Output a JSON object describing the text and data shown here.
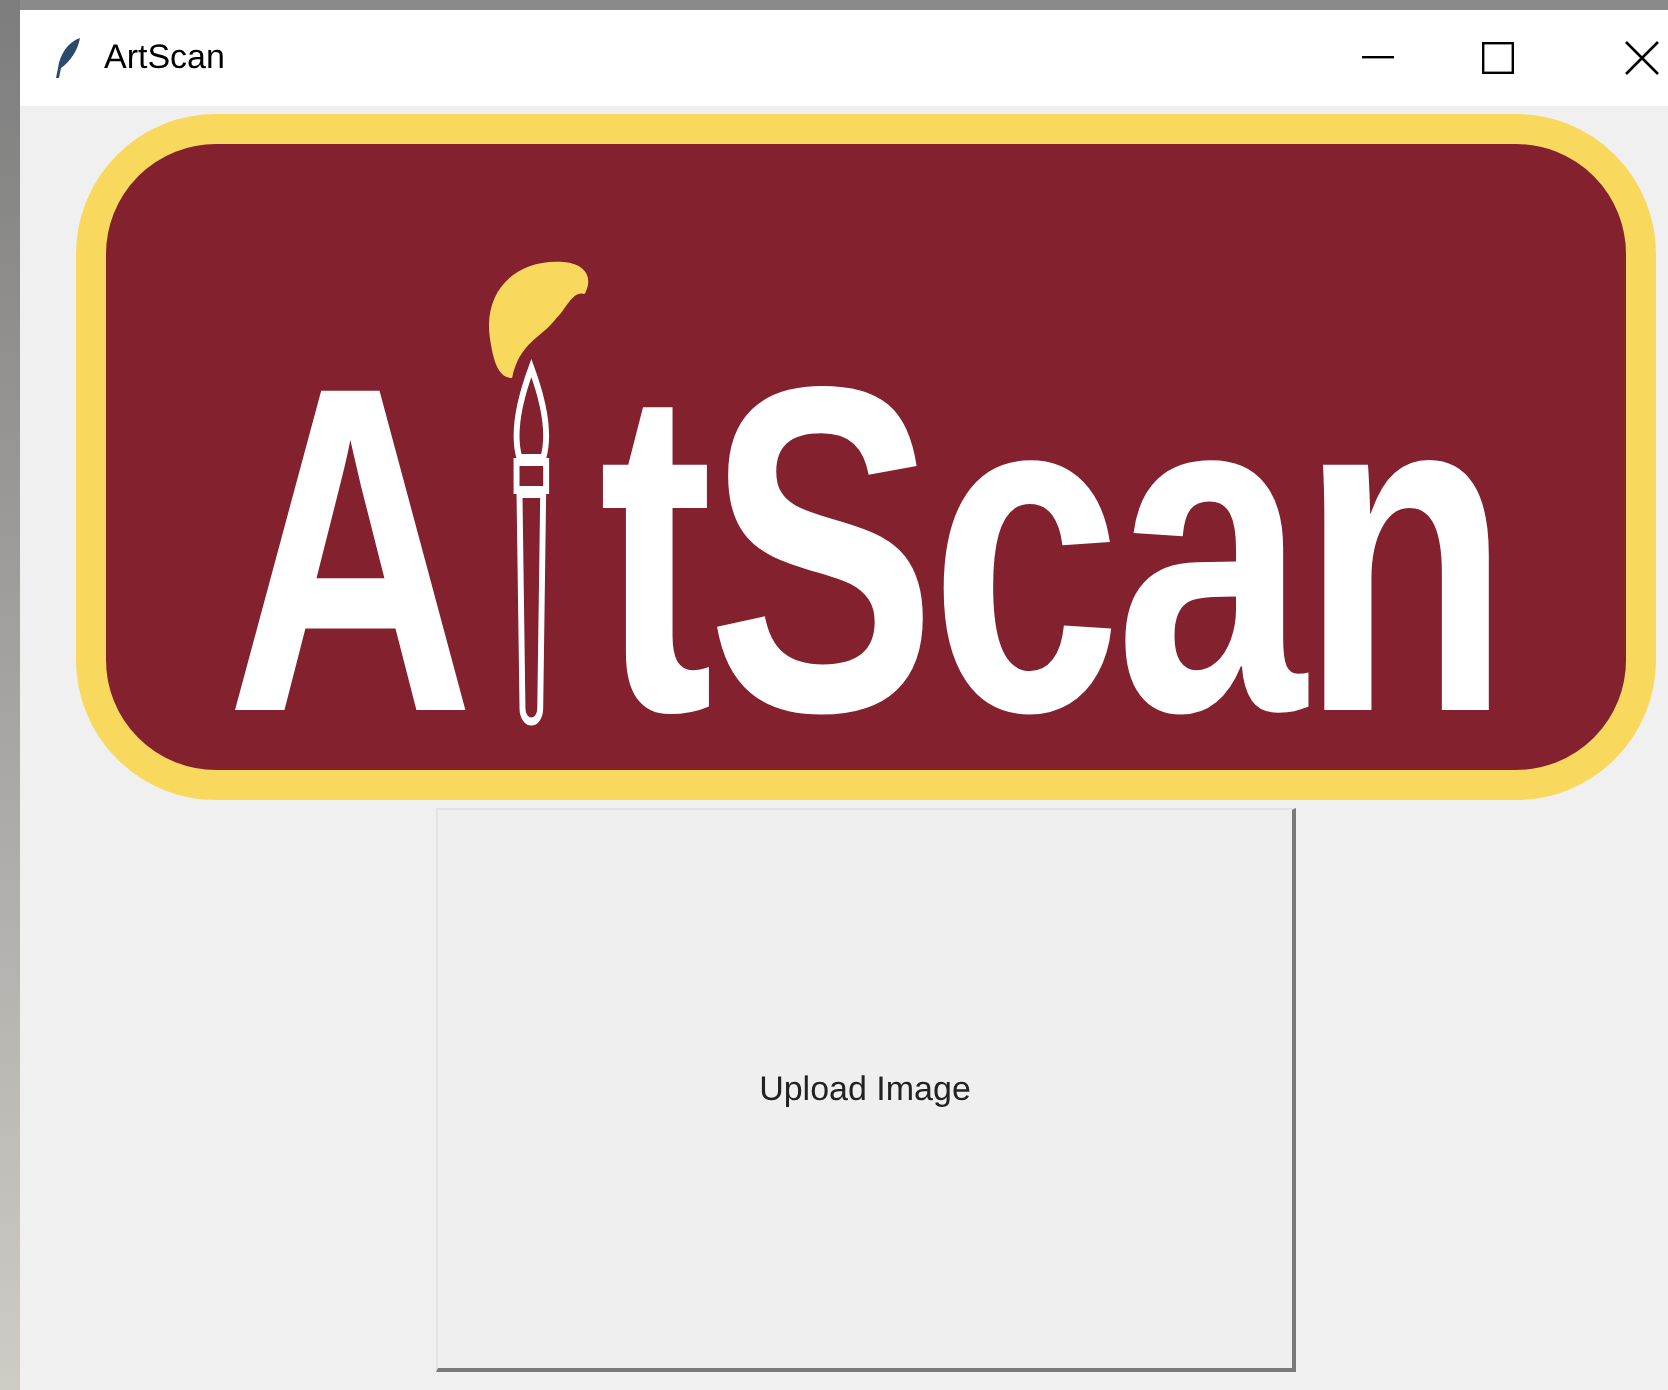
{
  "window": {
    "title": "ArtScan"
  },
  "logo": {
    "before_brush": "A",
    "after_brush": "tScan"
  },
  "upload_button": {
    "label": "Upload Image"
  }
}
